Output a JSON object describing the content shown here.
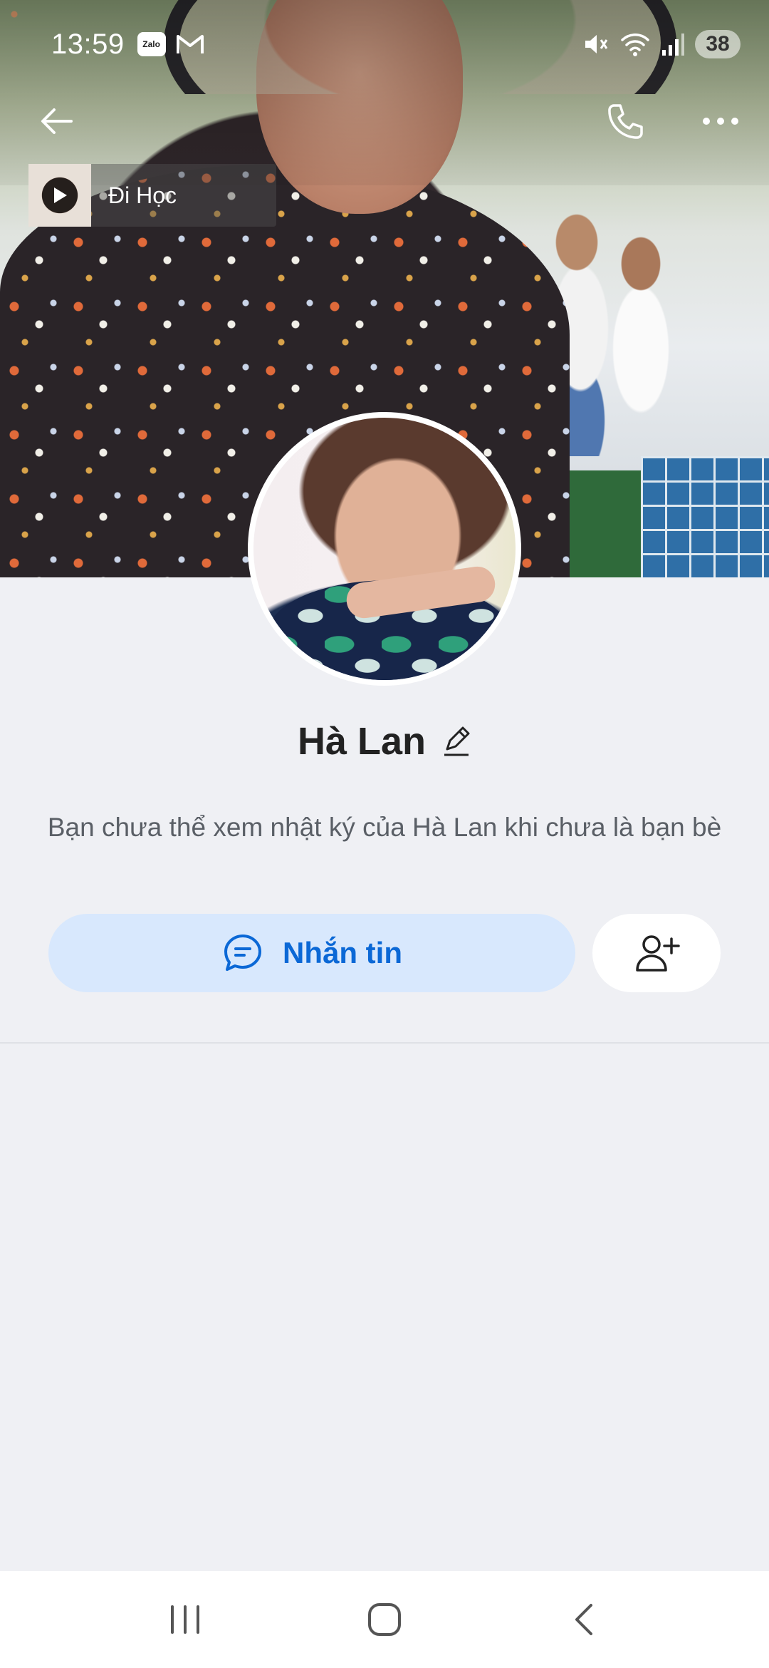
{
  "status_bar": {
    "time": "13:59",
    "app_icon_text": "Zalo",
    "battery": "38"
  },
  "music": {
    "title": "Đi Học"
  },
  "profile": {
    "name": "Hà Lan",
    "privacy_note": "Bạn chưa thể xem nhật ký của Hà Lan khi chưa là bạn bè"
  },
  "actions": {
    "message_label": "Nhắn tin"
  },
  "colors": {
    "accent": "#0b68d6",
    "message_button_bg": "#d8e8fd",
    "page_bg": "#eff0f4"
  },
  "icons": {
    "back": "arrow-left-icon",
    "call": "phone-icon",
    "more": "more-horizontal-icon",
    "edit": "pencil-icon",
    "message": "chat-bubble-icon",
    "add_friend": "add-user-icon",
    "nav_recent": "recent-apps-icon",
    "nav_home": "home-icon",
    "nav_back": "chevron-left-icon"
  }
}
